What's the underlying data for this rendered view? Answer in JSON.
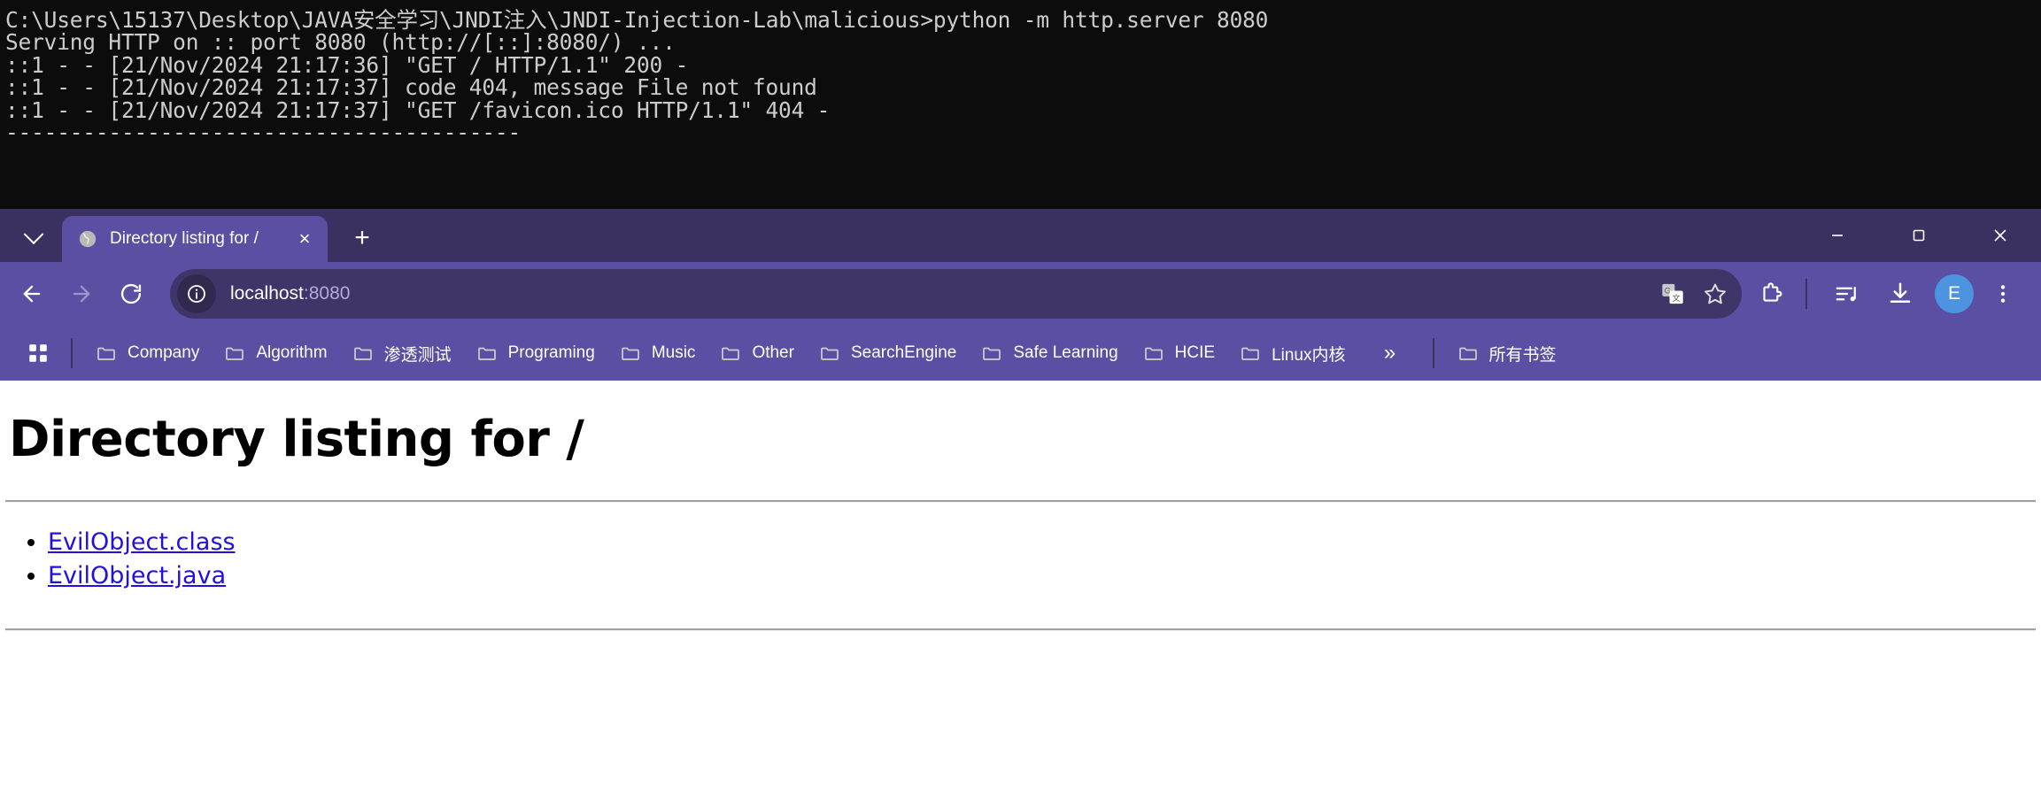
{
  "terminal": {
    "lines": [
      "C:\\Users\\15137\\Desktop\\JAVA安全学习\\JNDI注入\\JNDI-Injection-Lab\\malicious>python -m http.server 8080",
      "Serving HTTP on :: port 8080 (http://[::]:8080/) ...",
      "::1 - - [21/Nov/2024 21:17:36] \"GET / HTTP/1.1\" 200 -",
      "::1 - - [21/Nov/2024 21:17:37] code 404, message File not found",
      "::1 - - [21/Nov/2024 21:17:37] \"GET /favicon.ico HTTP/1.1\" 404 -",
      "----------------------------------------"
    ]
  },
  "browser": {
    "tabsearch": {
      "icon": "chevron-down-icon"
    },
    "tabs": [
      {
        "title": "Directory listing for /",
        "favicon": "globe-icon",
        "close": "×",
        "active": true
      }
    ],
    "newtab_label": "+",
    "window_controls": {
      "minimize": "minimize-icon",
      "maximize": "maximize-icon",
      "close": "close-icon"
    },
    "toolbar": {
      "back": "back-arrow-icon",
      "forward": "forward-arrow-icon",
      "reload": "reload-icon",
      "site_info": "info-circle-icon",
      "url_host": "localhost",
      "url_port": ":8080",
      "translate": "translate-icon",
      "bookmark_star": "star-icon",
      "extensions": "puzzle-piece-icon",
      "media": "media-control-icon",
      "downloads": "download-icon",
      "profile_initial": "E",
      "menu": "three-dot-menu-icon"
    },
    "bookmarks": {
      "apps_icon": "apps-grid-icon",
      "items": [
        {
          "label": "Company"
        },
        {
          "label": "Algorithm"
        },
        {
          "label": "渗透测试"
        },
        {
          "label": "Programing"
        },
        {
          "label": "Music"
        },
        {
          "label": "Other"
        },
        {
          "label": "SearchEngine"
        },
        {
          "label": "Safe Learning"
        },
        {
          "label": "HCIE"
        },
        {
          "label": "Linux内核"
        }
      ],
      "overflow_label": "»",
      "all_bookmarks_label": "所有书签"
    }
  },
  "page": {
    "heading": "Directory listing for /",
    "files": [
      {
        "name": "EvilObject.class"
      },
      {
        "name": "EvilObject.java"
      }
    ]
  },
  "colors": {
    "tabstrip_bg": "#3a3160",
    "toolbar_bg": "#5b4fa3",
    "active_tab_bg": "#5b4fa3",
    "omnibox_bg": "#3f3569",
    "terminal_bg": "#0c0c0c",
    "terminal_fg": "#cccccc",
    "link": "#2211dd",
    "avatar_bg": "#4d94e0"
  }
}
